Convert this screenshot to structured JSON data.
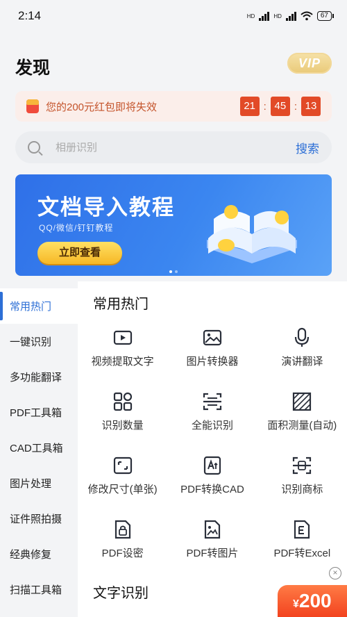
{
  "status_bar": {
    "time": "2:14",
    "network_label_1": "HD",
    "network_label_2": "HD",
    "battery": "67"
  },
  "header": {
    "title": "发现",
    "vip_label": "VIP"
  },
  "red_packet_banner": {
    "message": "您的200元红包即将失效",
    "countdown": {
      "hours": "21",
      "minutes": "45",
      "seconds": "13"
    }
  },
  "search": {
    "placeholder": "相册识别",
    "button_label": "搜索"
  },
  "promo_banner": {
    "title": "文档导入教程",
    "subtitle": "QQ/微信/钉钉教程",
    "button_label": "立即查看",
    "slide_count": 2,
    "active_slide": 1
  },
  "sidebar": {
    "items": [
      {
        "label": "常用热门",
        "active": true
      },
      {
        "label": "一键识别"
      },
      {
        "label": "多功能翻译"
      },
      {
        "label": "PDF工具箱"
      },
      {
        "label": "CAD工具箱"
      },
      {
        "label": "图片处理"
      },
      {
        "label": "证件照拍摄"
      },
      {
        "label": "经典修复"
      },
      {
        "label": "扫描工具箱"
      }
    ]
  },
  "main": {
    "section_title": "常用热门",
    "tools": [
      {
        "label": "视频提取文字",
        "icon": "video-icon"
      },
      {
        "label": "图片转换器",
        "icon": "image-icon"
      },
      {
        "label": "演讲翻译",
        "icon": "microphone-icon"
      },
      {
        "label": "识别数量",
        "icon": "grid-count-icon"
      },
      {
        "label": "全能识别",
        "icon": "scan-icon"
      },
      {
        "label": "面积测量(自动)",
        "icon": "area-measure-icon"
      },
      {
        "label": "修改尺寸(单张)",
        "icon": "resize-icon"
      },
      {
        "label": "PDF转换CAD",
        "icon": "pdf-cad-icon"
      },
      {
        "label": "识别商标",
        "icon": "trademark-scan-icon"
      },
      {
        "label": "PDF设密",
        "icon": "pdf-lock-icon"
      },
      {
        "label": "PDF转图片",
        "icon": "pdf-image-icon"
      },
      {
        "label": "PDF转Excel",
        "icon": "pdf-excel-icon"
      }
    ],
    "next_section_title": "文字识别"
  },
  "floating_packet": {
    "currency": "¥",
    "amount": "200",
    "close_symbol": "×"
  },
  "colors": {
    "accent": "#2d6fd6",
    "countdown": "#e24a27",
    "banner": "#3b86f0"
  }
}
